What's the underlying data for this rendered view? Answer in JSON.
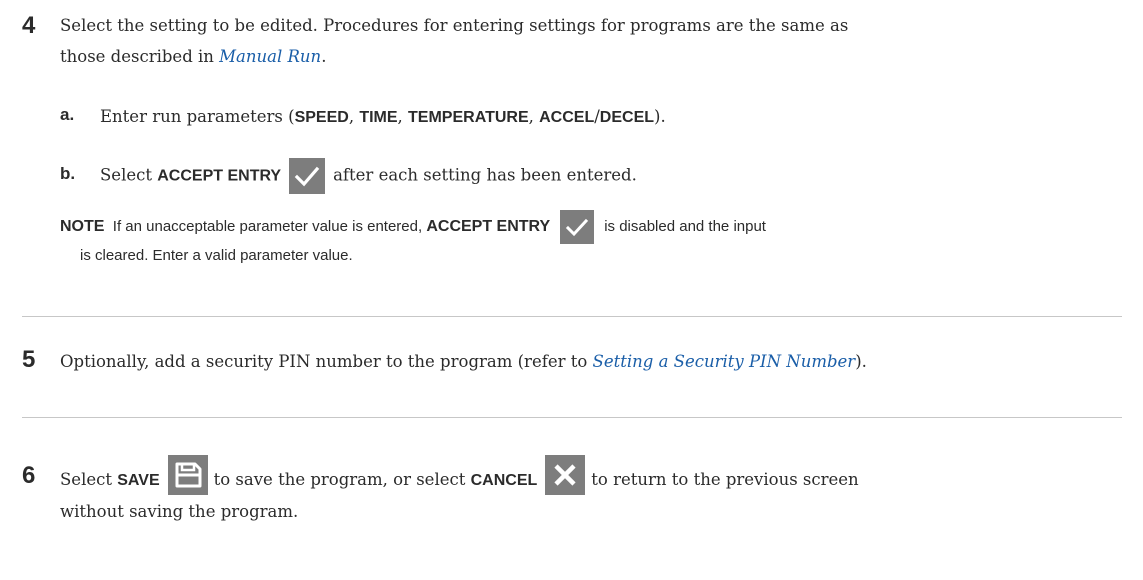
{
  "step4": {
    "number": "4",
    "text_before": "Select the setting to be edited. Procedures for entering settings for programs are the same as",
    "text_line2_before": "those described in ",
    "link": "Manual Run",
    "text_line2_after": ".",
    "sub_a": {
      "letter": "a.",
      "text_before": "Enter run parameters (",
      "kw1": "SPEED",
      "sep1": ", ",
      "kw2": "TIME",
      "sep2": ", ",
      "kw3": "TEMPERATURE",
      "sep3": ", ",
      "kw4": "ACCEL",
      "sep4": "/",
      "kw5": "DECEL",
      "text_after": ")."
    },
    "sub_b": {
      "letter": "b.",
      "text_before": "Select ",
      "kw": "ACCEPT ENTRY",
      "text_after": "after each setting has been entered.",
      "icon": "checkmark-icon"
    },
    "note": {
      "label": "NOTE",
      "text_before": "If an unacceptable parameter value is entered, ",
      "kw": "ACCEPT ENTRY",
      "text_after": "is disabled and the input",
      "text_line2": "is cleared. Enter a valid parameter value.",
      "icon": "checkmark-icon"
    }
  },
  "step5": {
    "number": "5",
    "text_before": "Optionally, add a security PIN number to the program (refer to ",
    "link": "Setting a Security PIN Number",
    "text_after": ")."
  },
  "step6": {
    "number": "6",
    "text_1": "Select ",
    "kw_save": "SAVE",
    "save_icon": "save-icon",
    "text_2": "to save the program, or select ",
    "kw_cancel": "CANCEL",
    "cancel_icon": "close-icon",
    "text_3": "to return to the previous screen",
    "text_line2": "without saving the program."
  },
  "colors": {
    "text": "#2b2b2b",
    "link": "#1a5ea8",
    "icon_bg": "#7d7d7d",
    "divider": "#c7c7c7"
  }
}
